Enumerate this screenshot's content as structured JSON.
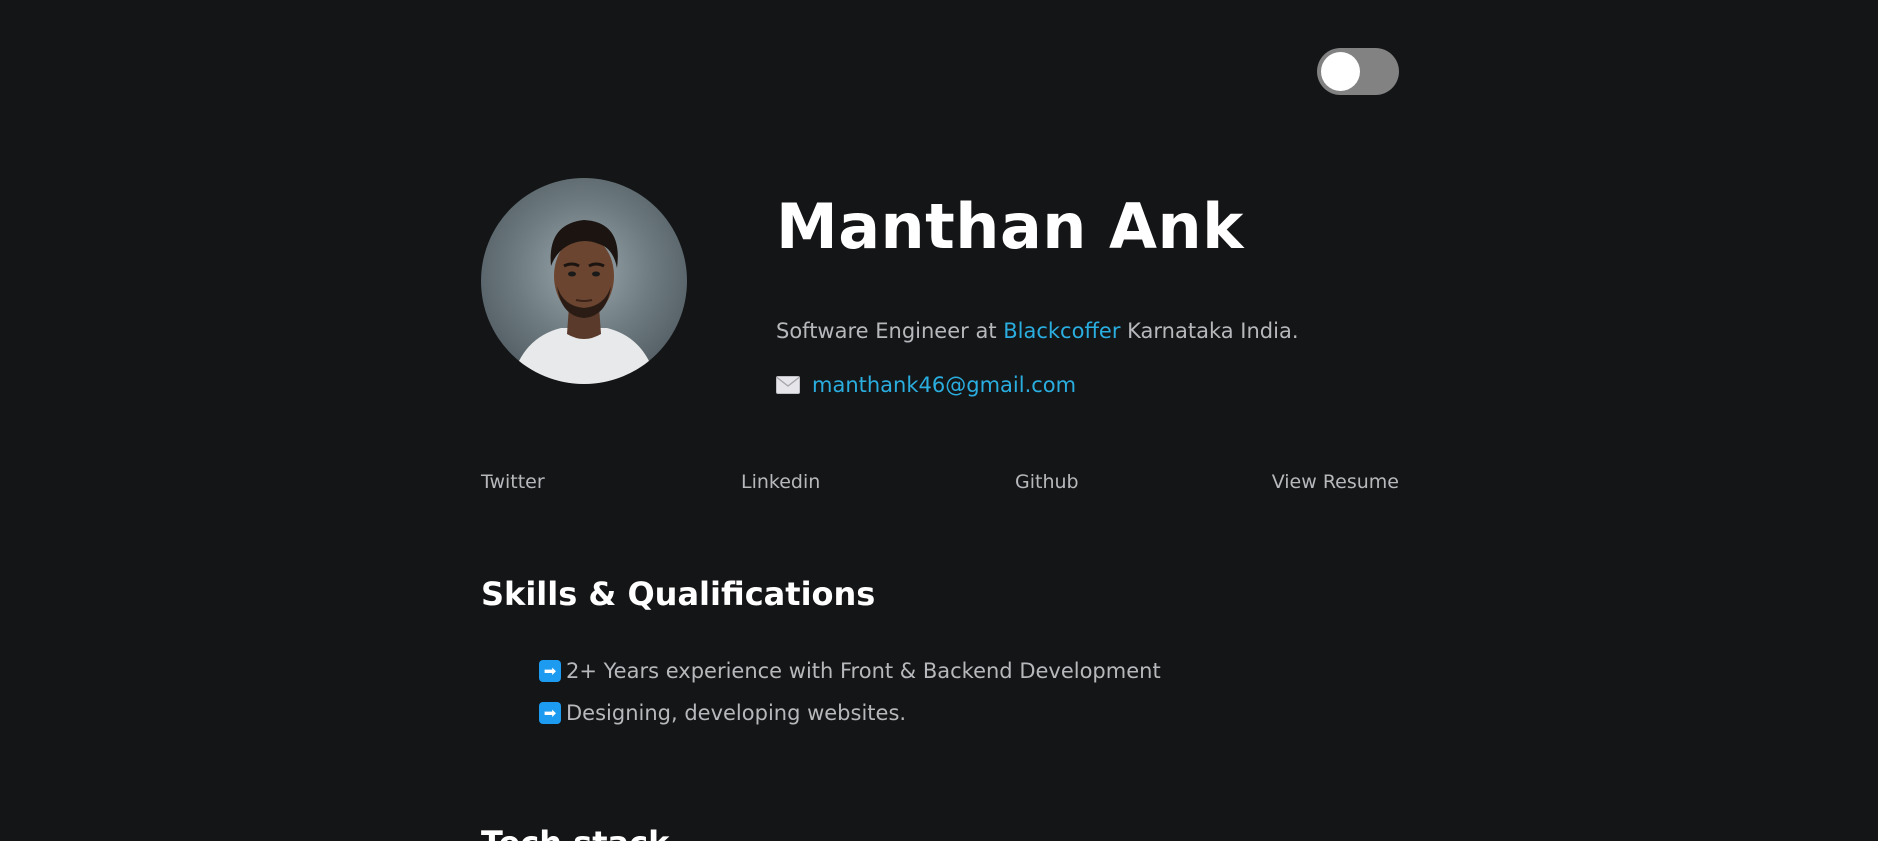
{
  "theme_toggle": {
    "state": "off"
  },
  "profile": {
    "avatar_alt": "Manthan Ank",
    "name": "Manthan Ank",
    "tagline_prefix": "Software Engineer at ",
    "company": "Blackcoffer",
    "tagline_suffix": " Karnataka India.",
    "email": "manthank46@gmail.com"
  },
  "links": {
    "twitter": "Twitter",
    "linkedin": "Linkedin",
    "github": "Github",
    "resume": "View Resume"
  },
  "skills": {
    "title": "Skills & Qualifications",
    "items": [
      "2+ Years experience with Front & Backend Development",
      "Designing, developing websites."
    ],
    "bullet_symbol": "➡"
  },
  "next_section": {
    "title": "Tech stack"
  },
  "colors": {
    "background": "#141517",
    "accent": "#2aaee0",
    "heading": "#ffffff",
    "body_text": "#b7b8bb",
    "toggle_track": "#828282",
    "bullet_badge": "#1d9bf0"
  }
}
